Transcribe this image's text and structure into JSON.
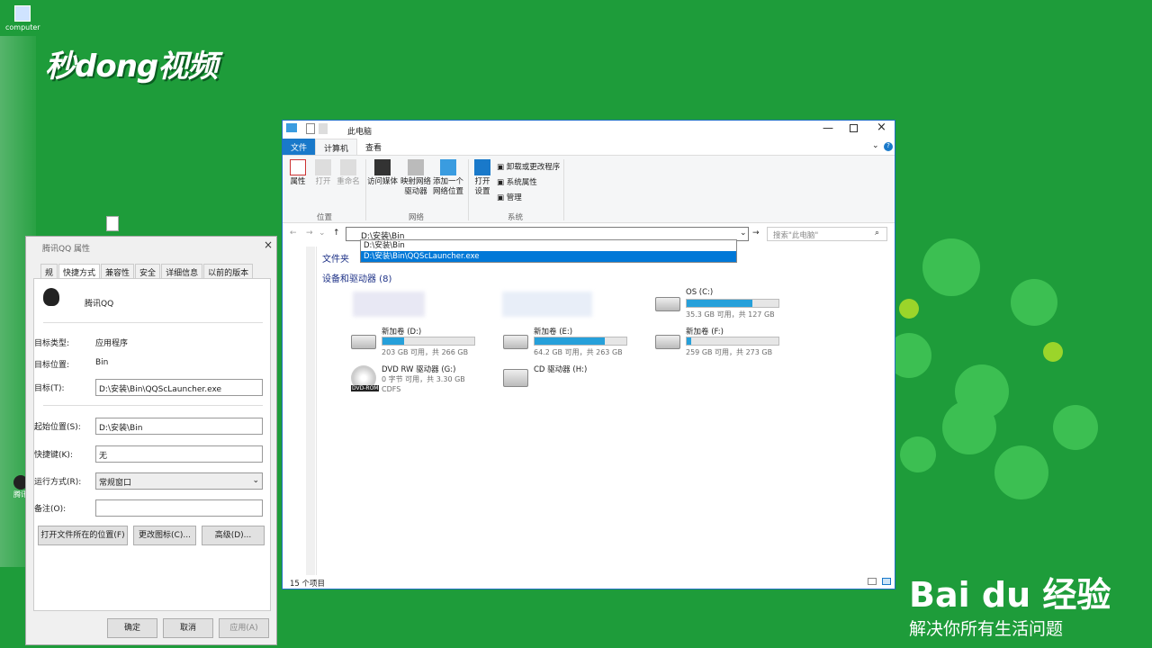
{
  "desktop": {
    "icon_label": "computer",
    "partial_icon_label": "腾讯"
  },
  "logo_text": "秒dong视频",
  "watermark": {
    "brand": "Bai du 经验",
    "slogan": "解决你所有生活问题"
  },
  "properties": {
    "title": "腾讯QQ 属性",
    "tabs": [
      "规",
      "快捷方式",
      "兼容性",
      "安全",
      "详细信息",
      "以前的版本"
    ],
    "active_tab": "快捷方式",
    "app_name": "腾讯QQ",
    "target_type_label": "目标类型:",
    "target_type_value": "应用程序",
    "target_location_label": "目标位置:",
    "target_location_value": "Bin",
    "target_label": "目标(T):",
    "target_value": "D:\\安装\\Bin\\QQScLauncher.exe",
    "start_in_label": "起始位置(S):",
    "start_in_value": "D:\\安装\\Bin",
    "shortcut_key_label": "快捷键(K):",
    "shortcut_key_value": "无",
    "run_label": "运行方式(R):",
    "run_value": "常规窗口",
    "comment_label": "备注(O):",
    "comment_value": "",
    "open_location_btn": "打开文件所在的位置(F)",
    "change_icon_btn": "更改图标(C)...",
    "advanced_btn": "高级(D)...",
    "ok_btn": "确定",
    "cancel_btn": "取消",
    "apply_btn": "应用(A)"
  },
  "explorer": {
    "title": "此电脑",
    "menu": [
      "文件",
      "计算机",
      "查看"
    ],
    "ribbon": {
      "properties": "属性",
      "open": "打开",
      "rename": "重命名",
      "group_location": "位置",
      "access_media": "访问媒体",
      "map_drive": "映射网络\n驱动器",
      "add_location": "添加一个\n网络位置",
      "group_network": "网络",
      "open_settings": "打开\n设置",
      "uninstall": "卸载或更改程序",
      "system_props": "系统属性",
      "manage": "管理",
      "group_system": "系统"
    },
    "address_value": "D:\\安装\\Bin",
    "search_placeholder": "搜索\"此电脑\"",
    "dropdown": [
      "D:\\安装\\Bin",
      "D:\\安装\\Bin\\QQScLauncher.exe"
    ],
    "folders_label": "文件夹",
    "devices_label": "设备和驱动器 (8)",
    "drives": [
      {
        "name": "OS (C:)",
        "info": "35.3 GB 可用，共 127 GB",
        "used": 0.72
      },
      {
        "name": "新加卷 (D:)",
        "info": "203 GB 可用，共 266 GB",
        "used": 0.24
      },
      {
        "name": "新加卷 (E:)",
        "info": "64.2 GB 可用，共 263 GB",
        "used": 0.76
      },
      {
        "name": "新加卷 (F:)",
        "info": "259 GB 可用，共 273 GB",
        "used": 0.05
      },
      {
        "name": "DVD RW 驱动器 (G:)",
        "info": "0 字节 可用，共 3.30 GB",
        "extra": "CDFS"
      },
      {
        "name": "CD 驱动器 (H:)",
        "info": ""
      }
    ],
    "dvd_badge": "DVD-ROM",
    "status": "15 个项目"
  },
  "colors": {
    "desktop": "#1e9c3a",
    "accent": "#0078d7",
    "drive_bar": "#26a0da"
  }
}
